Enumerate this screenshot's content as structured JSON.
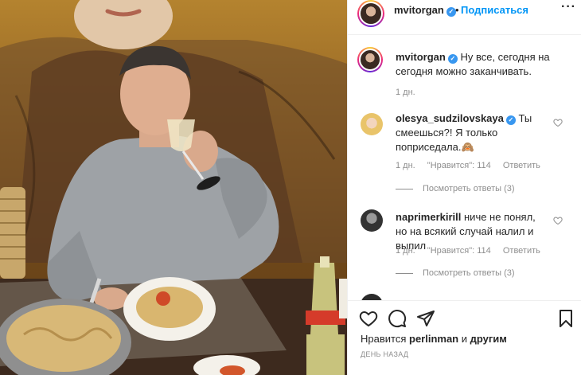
{
  "header": {
    "username": "mvitorgan",
    "separator": "•",
    "follow_label": "Подписаться",
    "more_icon": "more-horizontal-icon"
  },
  "caption": {
    "username": "mvitorgan",
    "text": "Ну все, сегодня на сегодня можно заканчивать.",
    "time": "1 дн."
  },
  "comments": [
    {
      "username": "olesya_sudzilovskaya",
      "verified": true,
      "text": "Ты смеешься?! Я только поприседала.🙈",
      "time": "1 дн.",
      "likes": "\"Нравится\": 114",
      "reply_label": "Ответить",
      "view_replies": "Посмотреть ответы (3)"
    },
    {
      "username": "naprimerkirill",
      "verified": false,
      "text": "ниче не понял, но на всякий случай налил и выпил",
      "time": "1 дн.",
      "likes": "\"Нравится\": 114",
      "reply_label": "Ответить",
      "view_replies": "Посмотреть ответы (3)"
    }
  ],
  "actions": {
    "icons": [
      "heart-icon",
      "comment-icon",
      "share-icon",
      "bookmark-icon"
    ],
    "likes_prefix": "Нравится",
    "likes_user": "perlinman",
    "likes_joiner": "и",
    "likes_others": "другим",
    "timestamp": "ДЕНЬ НАЗАД"
  },
  "colors": {
    "link": "#0095f6",
    "verified": "#3897f0",
    "muted": "#8e8e8e",
    "text": "#262626",
    "border": "#efefef"
  }
}
